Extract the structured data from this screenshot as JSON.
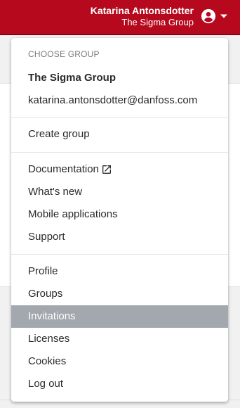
{
  "header": {
    "user_name": "Katarina Antonsdotter",
    "org_name": "The Sigma Group",
    "brand_color": "#b6091e",
    "avatar_icon": "account-circle-icon",
    "caret_icon": "caret-down-icon"
  },
  "menu": {
    "section_header": "CHOOSE GROUP",
    "current_group": "The Sigma Group",
    "email": "katarina.antonsdotter@danfoss.com",
    "create_group": "Create group",
    "links": {
      "documentation": "Documentation",
      "documentation_icon": "external-link-icon",
      "whats_new": "What's new",
      "mobile_apps": "Mobile applications",
      "support": "Support"
    },
    "account": {
      "profile": "Profile",
      "groups": "Groups",
      "invitations": "Invitations",
      "licenses": "Licenses",
      "cookies": "Cookies",
      "log_out": "Log out"
    },
    "active_item": "Invitations",
    "active_color": "#a2a8ae"
  }
}
